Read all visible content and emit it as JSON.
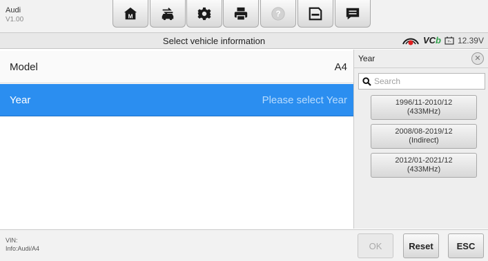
{
  "app": {
    "name": "Audi",
    "version": "V1.00"
  },
  "toolbar": {
    "buttons": [
      {
        "icon": "home-icon"
      },
      {
        "icon": "vehicle-swap-icon"
      },
      {
        "icon": "gear-icon"
      },
      {
        "icon": "printer-icon"
      },
      {
        "icon": "help-icon"
      },
      {
        "icon": "save-icon"
      },
      {
        "icon": "chat-icon"
      }
    ]
  },
  "status": {
    "title": "Select vehicle information",
    "vci_label": "VC",
    "vci_label_suffix": "b",
    "voltage": "12.39V"
  },
  "main": {
    "rows": [
      {
        "label": "Model",
        "value": "A4"
      },
      {
        "label": "Year",
        "value": "Please select Year"
      }
    ]
  },
  "panel": {
    "title": "Year",
    "search_placeholder": "Search",
    "options": [
      {
        "line1": "1996/11-2010/12",
        "line2": "(433MHz)"
      },
      {
        "line1": "2008/08-2019/12",
        "line2": "(Indirect)"
      },
      {
        "line1": "2012/01-2021/12",
        "line2": "(433MHz)"
      }
    ]
  },
  "bottom": {
    "vin_label": "VIN:",
    "info_label": "Info:Audi/A4",
    "ok_label": "OK",
    "reset_label": "Reset",
    "esc_label": "ESC"
  },
  "colors": {
    "accent": "#2b8ef0",
    "toolbar_bg": "#f2f2f2"
  }
}
